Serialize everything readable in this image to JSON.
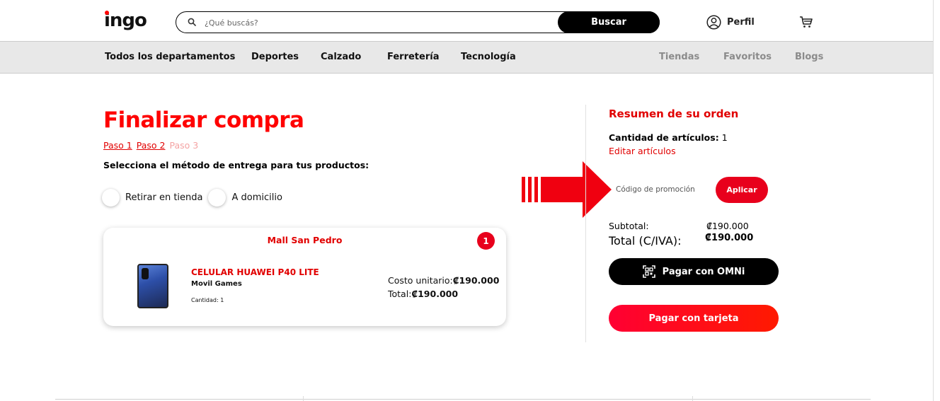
{
  "header": {
    "logo": "ingo",
    "search_placeholder": "¿Qué buscás?",
    "search_button": "Buscar",
    "profile_label": "Perfil"
  },
  "nav": {
    "left": [
      "Todos los departamentos",
      "Deportes",
      "Calzado",
      "Ferretería",
      "Tecnología"
    ],
    "right": [
      "Tiendas",
      "Favoritos",
      "Blogs"
    ]
  },
  "checkout": {
    "title": "Finalizar compra",
    "steps": [
      "Paso 1",
      "Paso 2",
      "Paso 3"
    ],
    "delivery_prompt": "Selecciona el método de entrega para tus productos:",
    "delivery_options": [
      "Retirar en tienda",
      "A domicilio"
    ],
    "store": {
      "name": "Mall San Pedro",
      "badge": "1",
      "product": {
        "name": "CELULAR HUAWEI P40 LITE",
        "brand": "Movil Games",
        "quantity": "Cantidad: 1",
        "unit_label": "Costo unitario:",
        "unit_price": "₡190.000",
        "total_label": "Total:",
        "total_price": "₡190.000"
      }
    }
  },
  "summary": {
    "title": "Resumen de su orden",
    "count_label": "Cantidad de artículos:",
    "count_value": "1",
    "edit_link": "Editar artículos",
    "promo_placeholder": "Código de promoción",
    "apply_button": "Aplicar",
    "subtotal_label": "Subtotal:",
    "subtotal_value": "₡190.000",
    "total_label": "Total (C/IVA):",
    "total_value": "₡190.000",
    "omni_button": "Pagar con OMNi",
    "card_button": "Pagar con tarjeta"
  },
  "colors": {
    "brand_red": "#e10000",
    "arrow_red": "#f00010",
    "black": "#000000",
    "nav_bg": "#e8e8e8"
  },
  "icons": [
    "search-icon",
    "user-icon",
    "cart-icon",
    "qr-icon",
    "arrow-right-icon"
  ]
}
